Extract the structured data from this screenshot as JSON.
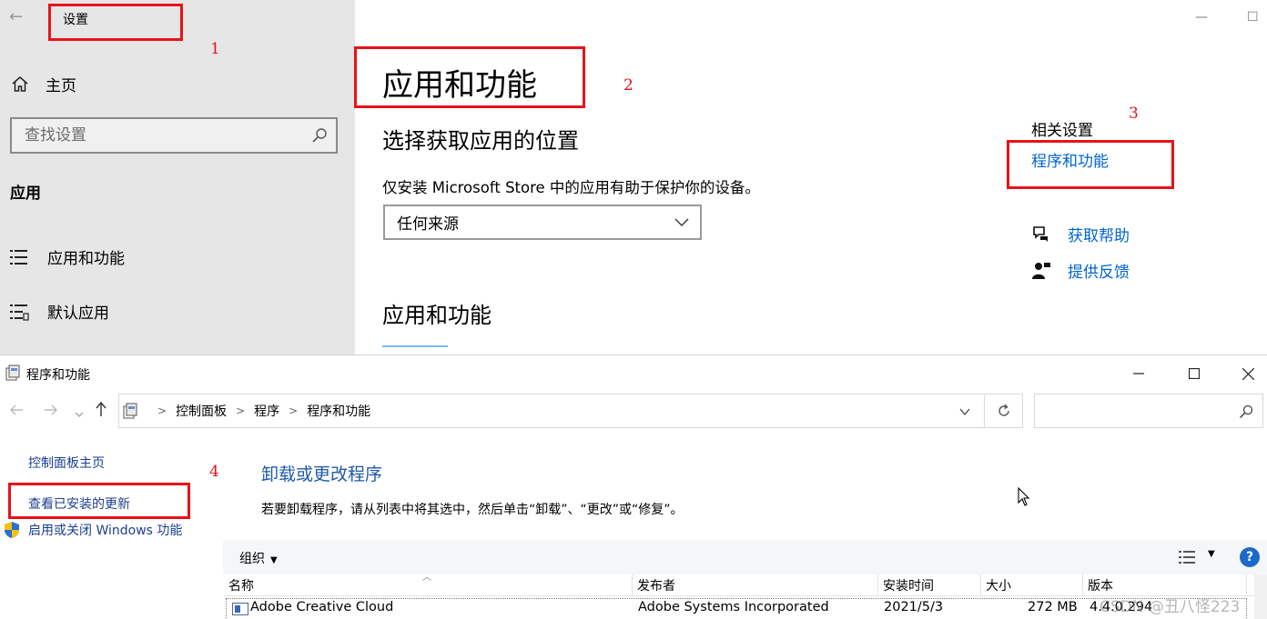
{
  "settings": {
    "window_title": "设置",
    "back_glyph": "←",
    "home_label": "主页",
    "search_placeholder": "查找设置",
    "section_label": "应用",
    "nav": [
      {
        "label": "应用和功能"
      },
      {
        "label": "默认应用"
      }
    ],
    "page_title": "应用和功能",
    "sub_heading": "选择获取应用的位置",
    "description": "仅安装 Microsoft Store 中的应用有助于保护你的设备。",
    "source_select_value": "任何来源",
    "apps_heading": "应用和功能",
    "related_title": "相关设置",
    "related_link": "程序和功能",
    "help_link": "获取帮助",
    "feedback_link": "提供反馈",
    "minimize_glyph": "—",
    "maximize_glyph": "☐"
  },
  "annotations": {
    "mark1": "1",
    "mark2": "2",
    "mark3": "3",
    "mark4": "4",
    "color": "#e8121a"
  },
  "programs": {
    "window_title": "程序和功能",
    "breadcrumb": [
      "控制面板",
      "程序",
      "程序和功能"
    ],
    "left_links": {
      "home": "控制面板主页",
      "updates": "查看已安装的更新",
      "features": "启用或关闭 Windows 功能"
    },
    "heading": "卸载或更改程序",
    "info": "若要卸载程序，请从列表中将其选中，然后单击“卸载”、“更改”或“修复”。",
    "toolbar": {
      "organize": "组织",
      "help": "?"
    },
    "columns": {
      "name": "名称",
      "publisher": "发布者",
      "installed": "安装时间",
      "size": "大小",
      "version": "版本"
    },
    "rows": [
      {
        "name": "Adobe Creative Cloud",
        "publisher": "Adobe Systems Incorporated",
        "installed": "2021/5/3",
        "size": "272 MB",
        "version": "4.4.0.294"
      }
    ],
    "watermark": "CSDN @丑八怪223",
    "link_color": "#1a3f8f",
    "heading_color": "#1e5aa8"
  }
}
